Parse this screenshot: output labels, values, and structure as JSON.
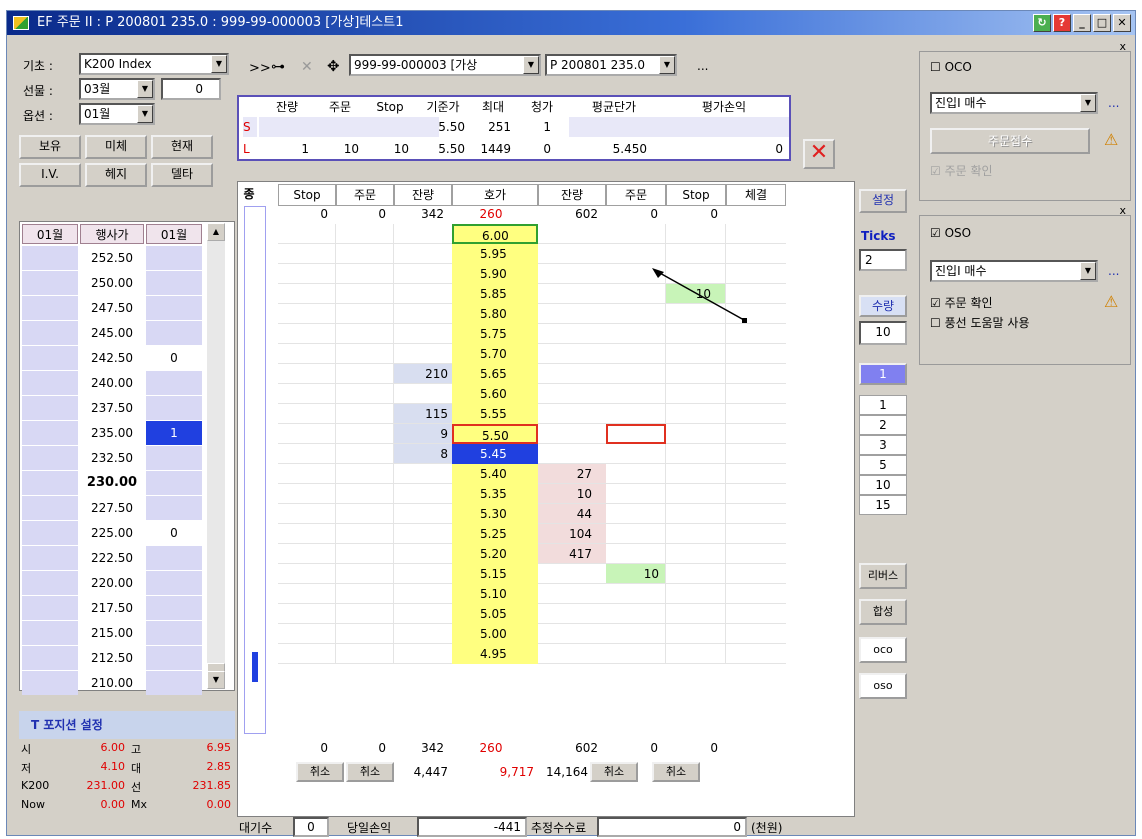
{
  "title": "EF 주문 II : P 200801 235.0 : 999-99-000003 [가상]테스트1",
  "left": {
    "base_label": "기초 :",
    "base_value": "K200 Index",
    "futures_label": "선물 :",
    "futures_month": "03월",
    "futures_qty": "0",
    "options_label": "옵션 :",
    "options_month": "01월",
    "tabs1": [
      "보유",
      "미체",
      "현재"
    ],
    "tabs2": [
      "I.V.",
      "헤지",
      "델타"
    ],
    "col_headers": [
      "01월",
      "행사가",
      "01월"
    ],
    "strikes": [
      "252.50",
      "250.00",
      "247.50",
      "245.00",
      "242.50",
      "240.00",
      "237.50",
      "235.00",
      "232.50",
      "230.00",
      "227.50",
      "225.00",
      "222.50",
      "220.00",
      "217.50",
      "215.00",
      "212.50",
      "210.00"
    ],
    "put_vals": {
      "242.50": "0",
      "235.00": "1",
      "225.00": "0"
    },
    "t_position": "T 포지션 설정",
    "stats": [
      {
        "l1": "시",
        "v1": "6.00",
        "l2": "고",
        "v2": "6.95"
      },
      {
        "l1": "저",
        "v1": "4.10",
        "l2": "대",
        "v2": "2.85"
      },
      {
        "l1": "K200",
        "v1": "231.00",
        "l2": "선",
        "v2": "231.85"
      },
      {
        "l1": "Now",
        "v1": "0.00",
        "l2": "Mx",
        "v2": "0.00"
      }
    ]
  },
  "toolbar": {
    "account": "999-99-000003 [가상",
    "symbol": "P 200801 235.0",
    "more": "..."
  },
  "summary": {
    "headers": [
      "잔량",
      "주문",
      "Stop",
      "기준가",
      "최대",
      "청가",
      "평균단가",
      "평가손익"
    ],
    "s_row": {
      "label": "S",
      "base": "5.50",
      "max": "251",
      "clear": "1"
    },
    "l_row": {
      "label": "L",
      "remain": "1",
      "order": "10",
      "stop": "10",
      "base": "5.50",
      "max": "1449",
      "clear": "0",
      "avg": "5.450",
      "pnl": "0"
    }
  },
  "ladder": {
    "headers": [
      "Stop",
      "주문",
      "잔량",
      "호가",
      "잔량",
      "주문",
      "Stop",
      "체결"
    ],
    "side_label": "종",
    "top": {
      "s_stop": "0",
      "s_order": "0",
      "s_remain": "342",
      "price": "260",
      "b_remain": "602",
      "b_order": "0",
      "b_stop": "0"
    },
    "rows": [
      {
        "p": "6.00",
        "sr": "",
        "br": "",
        "bo": "",
        "bs": ""
      },
      {
        "p": "5.95",
        "sr": "",
        "br": "",
        "bo": "",
        "bs": ""
      },
      {
        "p": "5.90",
        "sr": "",
        "br": "",
        "bo": "",
        "bs": ""
      },
      {
        "p": "5.85",
        "sr": "",
        "br": "",
        "bo": "",
        "bs": "10"
      },
      {
        "p": "5.80",
        "sr": "",
        "br": "",
        "bo": "",
        "bs": ""
      },
      {
        "p": "5.75",
        "sr": "",
        "br": "",
        "bo": "",
        "bs": ""
      },
      {
        "p": "5.70",
        "sr": "",
        "br": "",
        "bo": "",
        "bs": ""
      },
      {
        "p": "5.65",
        "sr": "210",
        "br": "",
        "bo": "",
        "bs": ""
      },
      {
        "p": "5.60",
        "sr": "",
        "br": "",
        "bo": "",
        "bs": ""
      },
      {
        "p": "5.55",
        "sr": "115",
        "br": "",
        "bo": "",
        "bs": ""
      },
      {
        "p": "5.50",
        "sr": "9",
        "br": "",
        "bo": "",
        "bs": ""
      },
      {
        "p": "5.45",
        "sr": "8",
        "br": "",
        "bo": "",
        "bs": ""
      },
      {
        "p": "5.40",
        "sr": "",
        "br": "27",
        "bo": "",
        "bs": ""
      },
      {
        "p": "5.35",
        "sr": "",
        "br": "10",
        "bo": "",
        "bs": ""
      },
      {
        "p": "5.30",
        "sr": "",
        "br": "44",
        "bo": "",
        "bs": ""
      },
      {
        "p": "5.25",
        "sr": "",
        "br": "104",
        "bo": "",
        "bs": ""
      },
      {
        "p": "5.20",
        "sr": "",
        "br": "417",
        "bo": "",
        "bs": ""
      },
      {
        "p": "5.15",
        "sr": "",
        "br": "",
        "bo": "10",
        "bs": ""
      },
      {
        "p": "5.10",
        "sr": "",
        "br": "",
        "bo": "",
        "bs": ""
      },
      {
        "p": "5.05",
        "sr": "",
        "br": "",
        "bo": "",
        "bs": ""
      },
      {
        "p": "5.00",
        "sr": "",
        "br": "",
        "bo": "",
        "bs": ""
      },
      {
        "p": "4.95",
        "sr": "",
        "br": "",
        "bo": "",
        "bs": ""
      }
    ],
    "bottom": {
      "s_stop": "0",
      "s_order": "0",
      "s_remain": "342",
      "price": "260",
      "b_remain": "602",
      "b_order": "0",
      "b_stop": "0"
    },
    "cancel": "취소",
    "bottom2": {
      "s_total": "4,447",
      "price_total": "9,717",
      "b_total": "14,164"
    }
  },
  "side": {
    "settings": "설정",
    "ticks_label": "Ticks",
    "ticks_value": "2",
    "qty_label": "수량",
    "qty_value": "10",
    "selected_qty": "1",
    "qty_options": [
      "1",
      "2",
      "3",
      "5",
      "10",
      "15"
    ],
    "reverse": "리버스",
    "combine": "합성",
    "oco": "oco",
    "oso": "oso"
  },
  "status": {
    "waiting_label": "대기수",
    "waiting_value": "0",
    "daily_pnl_label": "당일손익",
    "daily_pnl_value": "-441",
    "fee_label": "추정수수료",
    "fee_value": "0",
    "unit": "(천원)"
  },
  "oco": {
    "title": "OCO",
    "checked": false,
    "entry": "진입I 매수",
    "button": "주문접수",
    "confirm": "주문 확인"
  },
  "oso": {
    "title": "OSO",
    "checked": true,
    "entry": "진입I 매수",
    "confirm": "주문 확인",
    "balloon": "풍선 도움말 사용"
  },
  "colors": {
    "ask_bg": "#d8def0",
    "bid_bg": "#f2dcdc",
    "price_bg": "#ffff80",
    "selected": "#2040e0",
    "stop_bg": "#c8f4b8"
  }
}
